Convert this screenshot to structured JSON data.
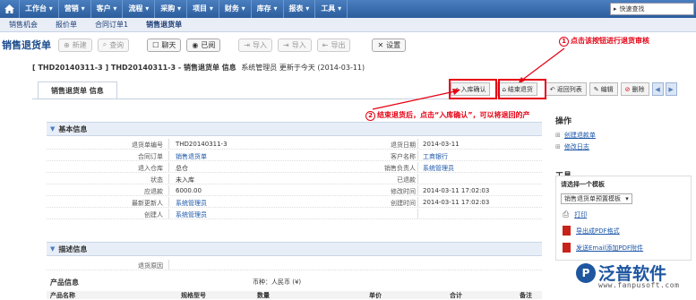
{
  "nav": {
    "menu": [
      "工作台 ▾",
      "营销 ▾",
      "客户 ▾",
      "流程 ▾",
      "采购 ▾",
      "项目 ▾",
      "财务 ▾",
      "库存 ▾",
      "报表 ▾",
      "工具 ▾"
    ],
    "search_label": "快速查找"
  },
  "subnav": [
    "销售机会",
    "报价单",
    "合同订单1",
    "销售退货单"
  ],
  "toolbar": {
    "title": "销售退货单",
    "buttons": [
      "新建",
      "查询",
      "聊天",
      "已阅",
      "导入",
      "导入",
      "导出",
      "设置"
    ]
  },
  "record": {
    "header_id": "[ THD20140311-3 ] THD20140311-3 - 销售退货单 信息",
    "header_meta": "系统管理员 更新于今天 (2014-03-11)",
    "tab": "销售退货单 信息"
  },
  "actions": [
    "入库确认",
    "结束退货",
    "返回列表",
    "编辑",
    "删除"
  ],
  "annotations": {
    "a1_num": "1",
    "a1_text": "点击该按钮进行退货审核",
    "a2_num": "2",
    "a2_text": "结束退货后，点击“入库确认”，可以将退回的产品重新存入对应的退货仓库"
  },
  "basic": {
    "section": "基本信息",
    "rows": [
      {
        "l1": "退货单编号",
        "v1": "THD20140311-3",
        "l2": "退货日期",
        "v2": "2014-03-11",
        "link1": false,
        "link2": false
      },
      {
        "l1": "合同订单",
        "v1": "销售退货单",
        "l2": "客户名称",
        "v2": "工商银行",
        "link1": true,
        "link2": true
      },
      {
        "l1": "退入仓库",
        "v1": "总仓",
        "l2": "销售负责人",
        "v2": "系统管理员",
        "link1": false,
        "link2": true
      },
      {
        "l1": "状态",
        "v1": "未入库",
        "l2": "已退款",
        "v2": "",
        "link1": false,
        "link2": false
      },
      {
        "l1": "应退款",
        "v1": "6000.00",
        "l2": "修改时间",
        "v2": "2014-03-11 17:02:03",
        "link1": false,
        "link2": false
      },
      {
        "l1": "最新更新人",
        "v1": "系统管理员",
        "l2": "创建时间",
        "v2": "2014-03-11 17:02:03",
        "link1": true,
        "link2": false
      },
      {
        "l1": "创建人",
        "v1": "系统管理员",
        "l2": "",
        "v2": "",
        "link1": true,
        "link2": false
      }
    ]
  },
  "desc": {
    "section": "描述信息",
    "label": "退货原因"
  },
  "product": {
    "label": "产品信息",
    "currency": "币种：人民币 (¥)",
    "cols": [
      "产品名称",
      "规格型号",
      "数量",
      "单价",
      "合计",
      "备注"
    ]
  },
  "sidebar": {
    "ops_title": "操作",
    "ops": [
      "创建退款单",
      "修改日志"
    ],
    "tools_title": "工具",
    "tpl_label": "请选择一个模板",
    "tpl_select": "销售退货单预置模板",
    "tools": [
      "打印",
      "导出成PDF格式",
      "发送Email添加PDF附件"
    ]
  },
  "brand": {
    "mark": "P",
    "name": "泛普软件",
    "url": "www.fanpusoft.com"
  },
  "colors": {
    "nav_blue": "#2c5d9c",
    "annotation_red": "#e60012",
    "link_blue": "#1a55a8"
  }
}
